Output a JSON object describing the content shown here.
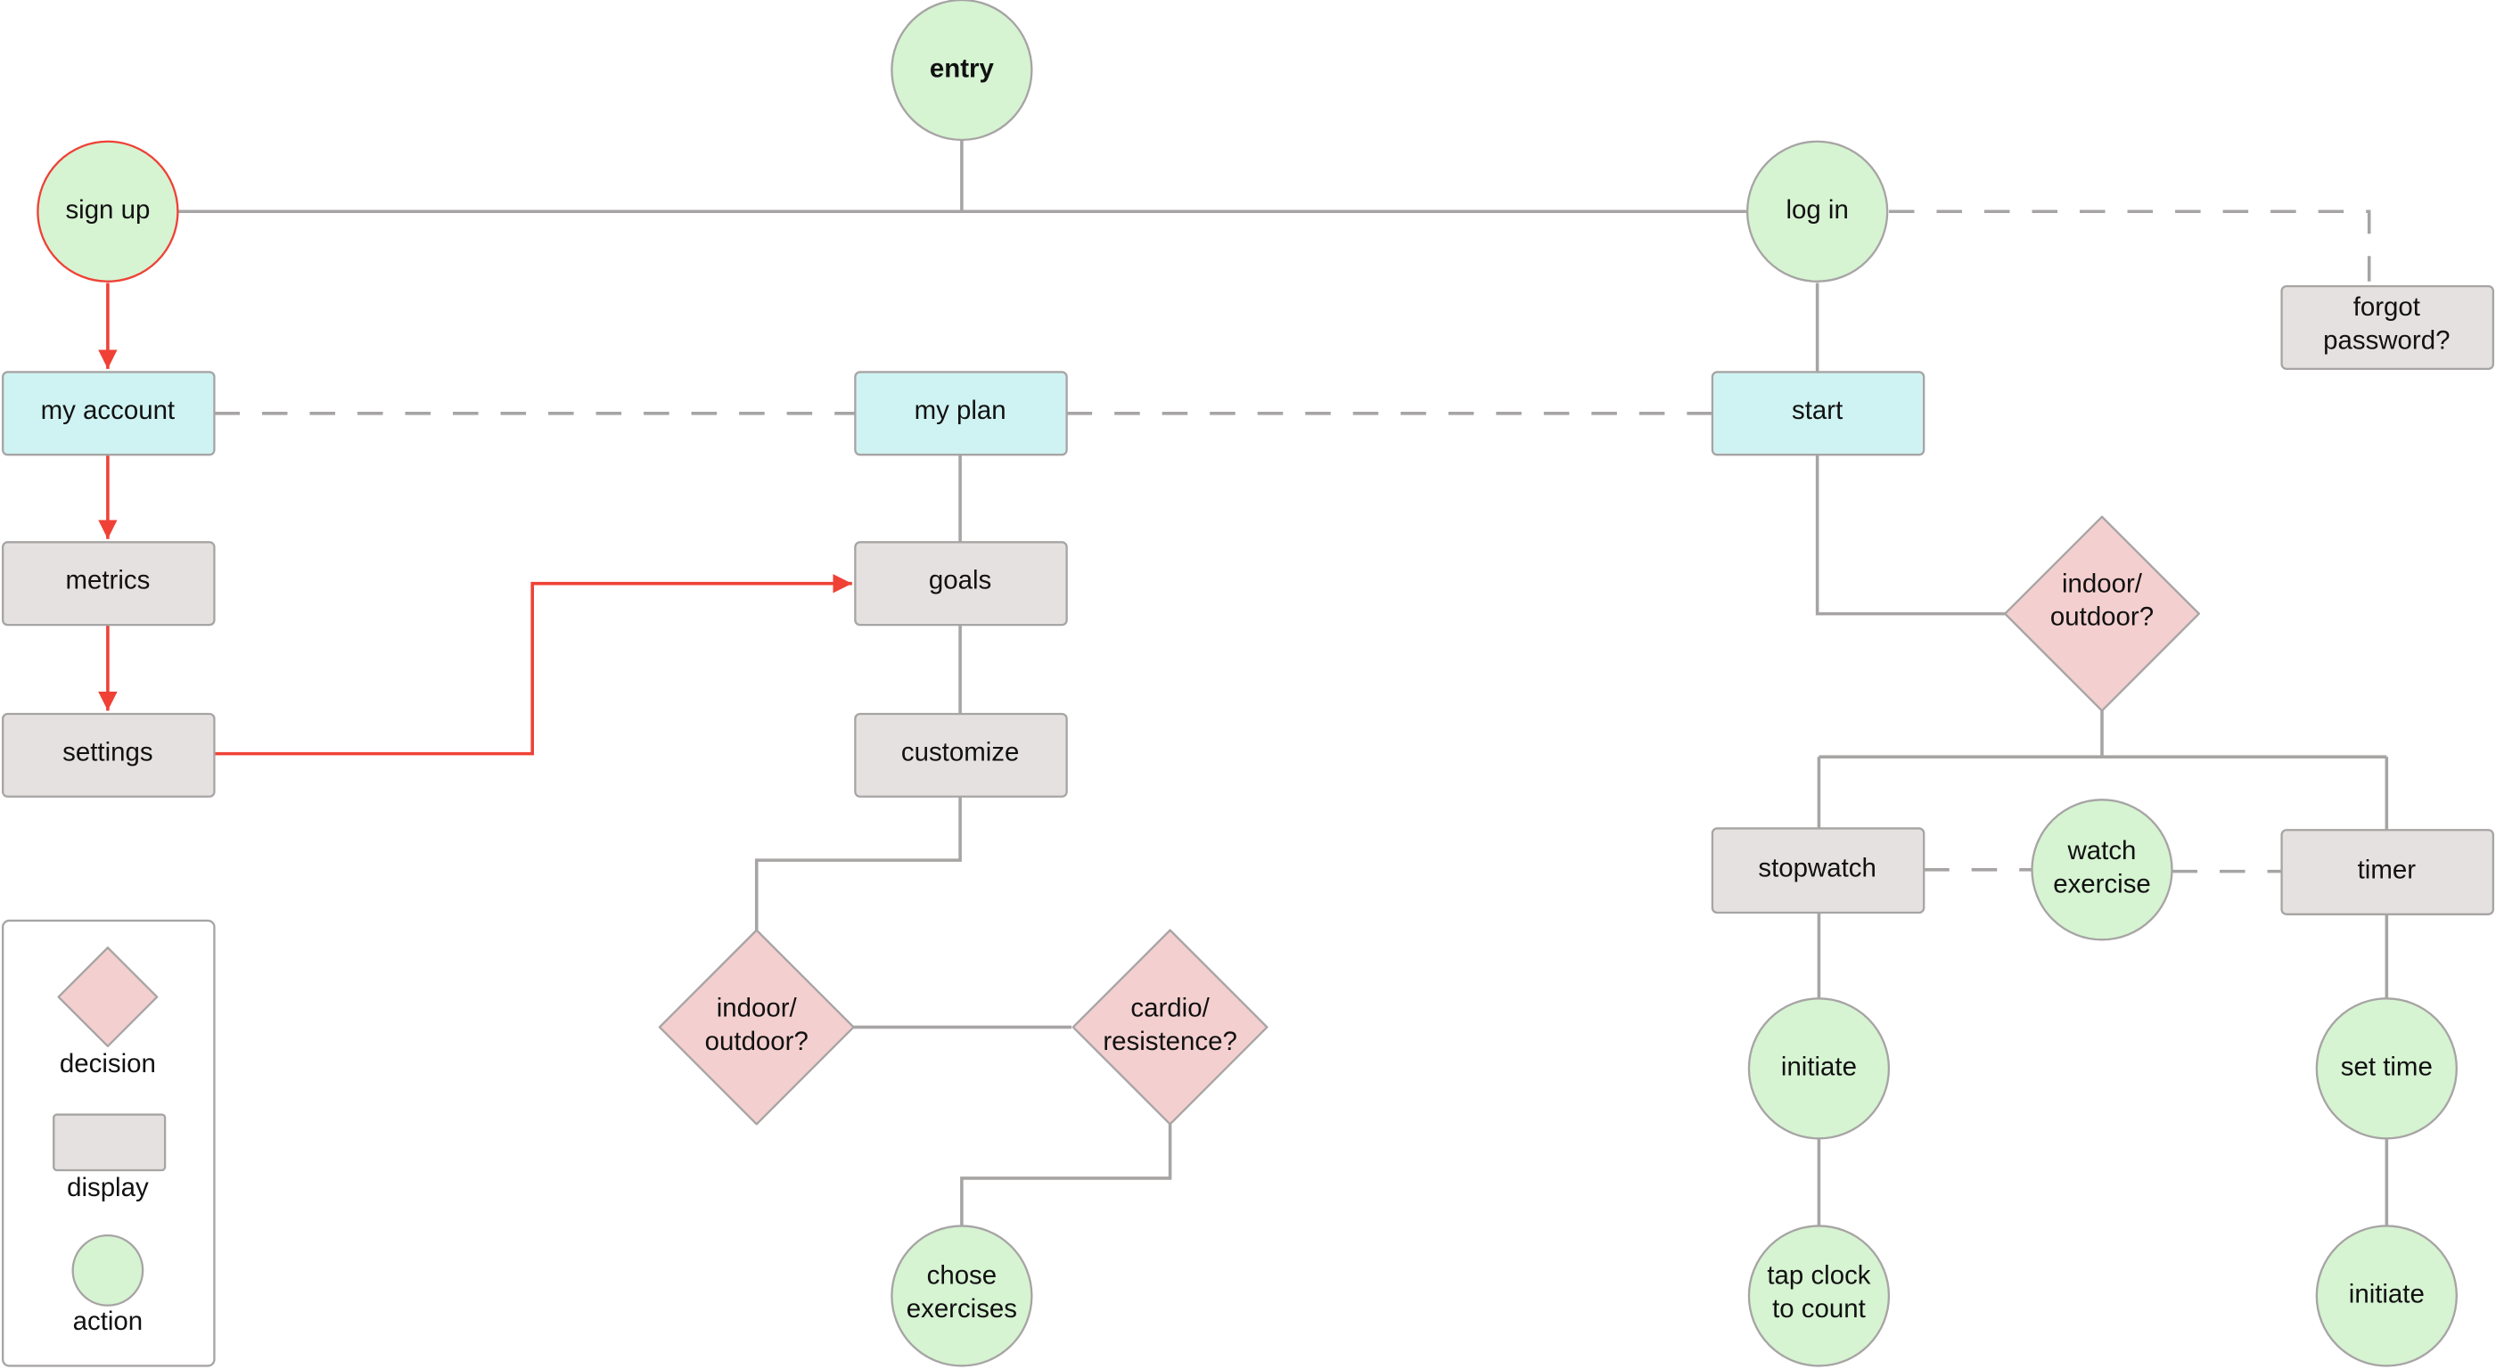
{
  "diagram": {
    "nodes": {
      "entry": {
        "label": [
          "entry"
        ],
        "type": "action"
      },
      "sign_up": {
        "label": [
          "sign up"
        ],
        "type": "action",
        "highlight": "#ef4136"
      },
      "log_in": {
        "label": [
          "log in"
        ],
        "type": "action"
      },
      "forgot_password": {
        "label": [
          "forgot",
          "password?"
        ],
        "type": "display"
      },
      "my_account": {
        "label": [
          "my account"
        ],
        "type": "screen"
      },
      "my_plan": {
        "label": [
          "my plan"
        ],
        "type": "screen"
      },
      "start": {
        "label": [
          "start"
        ],
        "type": "screen"
      },
      "metrics": {
        "label": [
          "metrics"
        ],
        "type": "display"
      },
      "settings": {
        "label": [
          "settings"
        ],
        "type": "display"
      },
      "goals": {
        "label": [
          "goals"
        ],
        "type": "display"
      },
      "customize": {
        "label": [
          "customize"
        ],
        "type": "display"
      },
      "plan_indoor_outdoor": {
        "label": [
          "indoor/",
          "outdoor?"
        ],
        "type": "decision"
      },
      "cardio_resistence": {
        "label": [
          "cardio/",
          "resistence?"
        ],
        "type": "decision"
      },
      "chose_exercises": {
        "label": [
          "chose",
          "exercises"
        ],
        "type": "action"
      },
      "start_indoor_outdoor": {
        "label": [
          "indoor/",
          "outdoor?"
        ],
        "type": "decision"
      },
      "stopwatch": {
        "label": [
          "stopwatch"
        ],
        "type": "display"
      },
      "watch_exercise": {
        "label": [
          "watch",
          "exercise"
        ],
        "type": "action"
      },
      "timer": {
        "label": [
          "timer"
        ],
        "type": "display"
      },
      "sw_initiate": {
        "label": [
          "initiate"
        ],
        "type": "action"
      },
      "tap_clock": {
        "label": [
          "tap clock",
          "to count"
        ],
        "type": "action"
      },
      "set_time": {
        "label": [
          "set time"
        ],
        "type": "action"
      },
      "timer_initiate": {
        "label": [
          "initiate"
        ],
        "type": "action"
      }
    },
    "edges": [
      {
        "from": "entry",
        "to": "sign_up",
        "style": "solid"
      },
      {
        "from": "entry",
        "to": "log_in",
        "style": "solid"
      },
      {
        "from": "log_in",
        "to": "forgot_password",
        "style": "dashed"
      },
      {
        "from": "log_in",
        "to": "start",
        "style": "solid"
      },
      {
        "from": "sign_up",
        "to": "my_account",
        "style": "red-arrow"
      },
      {
        "from": "my_account",
        "to": "metrics",
        "style": "red-arrow"
      },
      {
        "from": "metrics",
        "to": "settings",
        "style": "red-arrow"
      },
      {
        "from": "settings",
        "to": "goals",
        "style": "red-arrow"
      },
      {
        "from": "my_account",
        "to": "my_plan",
        "style": "dashed"
      },
      {
        "from": "my_plan",
        "to": "start",
        "style": "dashed"
      },
      {
        "from": "my_plan",
        "to": "goals",
        "style": "solid"
      },
      {
        "from": "goals",
        "to": "customize",
        "style": "solid"
      },
      {
        "from": "customize",
        "to": "plan_indoor_outdoor",
        "style": "solid"
      },
      {
        "from": "plan_indoor_outdoor",
        "to": "cardio_resistence",
        "style": "solid"
      },
      {
        "from": "cardio_resistence",
        "to": "chose_exercises",
        "style": "solid"
      },
      {
        "from": "start",
        "to": "start_indoor_outdoor",
        "style": "solid"
      },
      {
        "from": "start_indoor_outdoor",
        "to": "stopwatch",
        "style": "solid"
      },
      {
        "from": "start_indoor_outdoor",
        "to": "timer",
        "style": "solid"
      },
      {
        "from": "stopwatch",
        "to": "watch_exercise",
        "style": "dashed"
      },
      {
        "from": "watch_exercise",
        "to": "timer",
        "style": "dashed"
      },
      {
        "from": "stopwatch",
        "to": "sw_initiate",
        "style": "solid"
      },
      {
        "from": "sw_initiate",
        "to": "tap_clock",
        "style": "solid"
      },
      {
        "from": "timer",
        "to": "set_time",
        "style": "solid"
      },
      {
        "from": "set_time",
        "to": "timer_initiate",
        "style": "solid"
      }
    ]
  },
  "legend": {
    "decision": "decision",
    "display": "display",
    "action": "action"
  },
  "colors": {
    "action_fill": "#d6f3d2",
    "display_fill": "#e5e1e0",
    "screen_fill": "#cff3f2",
    "decision_fill": "#f4cfcf",
    "connector": "#a7a4a4",
    "highlight_path": "#ef4136"
  }
}
